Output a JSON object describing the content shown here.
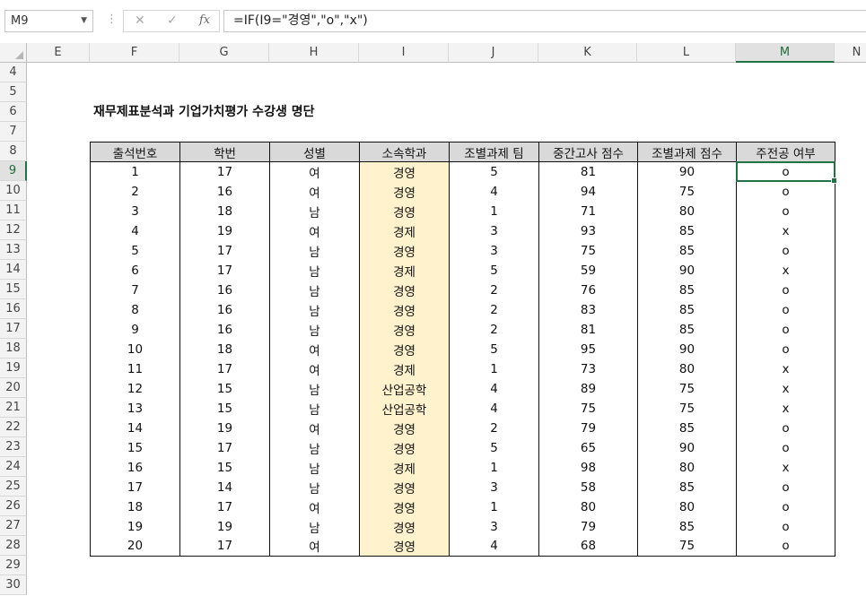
{
  "formula_bar": {
    "name_box": "M9",
    "cancel_glyph": "✕",
    "enter_glyph": "✓",
    "fx_label": "fx",
    "formula": "=IF(I9=\"경영\",\"o\",\"x\")"
  },
  "columns": [
    "E",
    "F",
    "G",
    "H",
    "I",
    "J",
    "K",
    "L",
    "M",
    "N"
  ],
  "selected_column": "M",
  "rows": [
    "4",
    "5",
    "6",
    "7",
    "8",
    "9",
    "10",
    "11",
    "12",
    "13",
    "14",
    "15",
    "16",
    "17",
    "18",
    "19",
    "20",
    "21",
    "22",
    "23",
    "24",
    "25",
    "26",
    "27",
    "28",
    "29",
    "30"
  ],
  "selected_row": "9",
  "title": "재무제표분석과 기업가치평가 수강생 명단",
  "table": {
    "headers": [
      "출석번호",
      "학번",
      "성별",
      "소속학과",
      "조별과제 팀",
      "중간고사 점수",
      "조별과제 점수",
      "주전공 여부"
    ],
    "rows": [
      [
        "1",
        "17",
        "여",
        "경영",
        "5",
        "81",
        "90",
        "o"
      ],
      [
        "2",
        "16",
        "여",
        "경영",
        "4",
        "94",
        "75",
        "o"
      ],
      [
        "3",
        "18",
        "남",
        "경영",
        "1",
        "71",
        "80",
        "o"
      ],
      [
        "4",
        "19",
        "여",
        "경제",
        "3",
        "93",
        "85",
        "x"
      ],
      [
        "5",
        "17",
        "남",
        "경영",
        "3",
        "75",
        "85",
        "o"
      ],
      [
        "6",
        "17",
        "남",
        "경제",
        "5",
        "59",
        "90",
        "x"
      ],
      [
        "7",
        "16",
        "남",
        "경영",
        "2",
        "76",
        "85",
        "o"
      ],
      [
        "8",
        "16",
        "남",
        "경영",
        "2",
        "83",
        "85",
        "o"
      ],
      [
        "9",
        "16",
        "남",
        "경영",
        "2",
        "81",
        "85",
        "o"
      ],
      [
        "10",
        "18",
        "여",
        "경영",
        "5",
        "95",
        "90",
        "o"
      ],
      [
        "11",
        "17",
        "여",
        "경제",
        "1",
        "73",
        "80",
        "x"
      ],
      [
        "12",
        "15",
        "남",
        "산업공학",
        "4",
        "89",
        "75",
        "x"
      ],
      [
        "13",
        "15",
        "남",
        "산업공학",
        "4",
        "75",
        "75",
        "x"
      ],
      [
        "14",
        "19",
        "여",
        "경영",
        "2",
        "79",
        "85",
        "o"
      ],
      [
        "15",
        "17",
        "남",
        "경영",
        "5",
        "65",
        "90",
        "o"
      ],
      [
        "16",
        "15",
        "남",
        "경제",
        "1",
        "98",
        "80",
        "x"
      ],
      [
        "17",
        "14",
        "남",
        "경영",
        "3",
        "58",
        "85",
        "o"
      ],
      [
        "18",
        "17",
        "여",
        "경영",
        "1",
        "80",
        "80",
        "o"
      ],
      [
        "19",
        "19",
        "남",
        "경영",
        "3",
        "79",
        "85",
        "o"
      ],
      [
        "20",
        "17",
        "여",
        "경영",
        "4",
        "68",
        "75",
        "o"
      ]
    ]
  },
  "colors": {
    "accent": "#217346",
    "dept_fill": "#fff2cc",
    "header_fill": "#d9d9d9"
  }
}
